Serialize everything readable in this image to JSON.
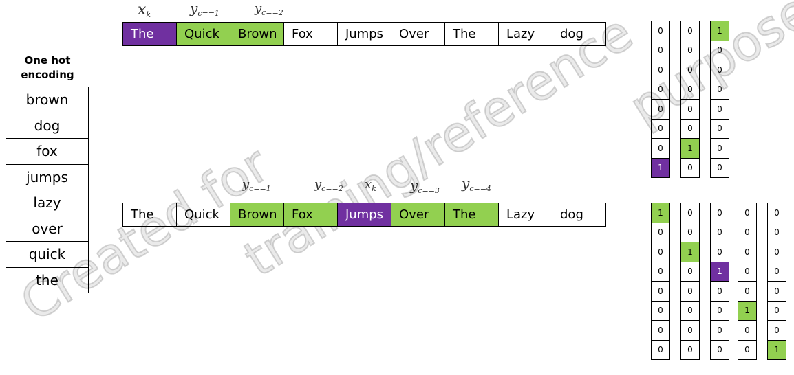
{
  "vocab": {
    "title_line1": "One hot",
    "title_line2": "encoding",
    "words": [
      "brown",
      "dog",
      "fox",
      "jumps",
      "lazy",
      "over",
      "quick",
      "the"
    ]
  },
  "top": {
    "tokens": [
      {
        "text": "The",
        "hl": "purple"
      },
      {
        "text": "Quick",
        "hl": "green"
      },
      {
        "text": "Brown",
        "hl": "green"
      },
      {
        "text": "Fox",
        "hl": ""
      },
      {
        "text": "Jumps",
        "hl": ""
      },
      {
        "text": "Over",
        "hl": ""
      },
      {
        "text": "The",
        "hl": ""
      },
      {
        "text": "Lazy",
        "hl": ""
      },
      {
        "text": "dog",
        "hl": ""
      }
    ],
    "labels": [
      {
        "main": "x",
        "sub": "k"
      },
      {
        "main": "y",
        "sub": "c==1"
      },
      {
        "main": "y",
        "sub": "c==2"
      }
    ],
    "vectors": [
      {
        "values": [
          0,
          0,
          0,
          0,
          0,
          0,
          0,
          1
        ],
        "hot_color": "purple"
      },
      {
        "values": [
          0,
          0,
          0,
          0,
          0,
          0,
          1,
          0
        ],
        "hot_color": "green"
      },
      {
        "values": [
          1,
          0,
          0,
          0,
          0,
          0,
          0,
          0
        ],
        "hot_color": "green"
      }
    ]
  },
  "bottom": {
    "tokens": [
      {
        "text": "The",
        "hl": ""
      },
      {
        "text": "Quick",
        "hl": ""
      },
      {
        "text": "Brown",
        "hl": "green"
      },
      {
        "text": "Fox",
        "hl": "green"
      },
      {
        "text": "Jumps",
        "hl": "purple"
      },
      {
        "text": "Over",
        "hl": "green"
      },
      {
        "text": "The",
        "hl": "green"
      },
      {
        "text": "Lazy",
        "hl": ""
      },
      {
        "text": "dog",
        "hl": ""
      }
    ],
    "labels": [
      {
        "main": "y",
        "sub": "c==1"
      },
      {
        "main": "y",
        "sub": "c==2"
      },
      {
        "main": "x",
        "sub": "k"
      },
      {
        "main": "y",
        "sub": "c==3"
      },
      {
        "main": "y",
        "sub": "c==4"
      }
    ],
    "vectors": [
      {
        "values": [
          1,
          0,
          0,
          0,
          0,
          0,
          0,
          0
        ],
        "hot_color": "green"
      },
      {
        "values": [
          0,
          0,
          1,
          0,
          0,
          0,
          0,
          0
        ],
        "hot_color": "green"
      },
      {
        "values": [
          0,
          0,
          0,
          1,
          0,
          0,
          0,
          0
        ],
        "hot_color": "purple"
      },
      {
        "values": [
          0,
          0,
          0,
          0,
          0,
          1,
          0,
          0
        ],
        "hot_color": "green"
      },
      {
        "values": [
          0,
          0,
          0,
          0,
          0,
          0,
          0,
          1
        ],
        "hot_color": "green"
      }
    ]
  },
  "watermark": {
    "line1": "Created for",
    "line2": "training/reference",
    "line3": "purposes"
  },
  "colors": {
    "purple": "#7030a0",
    "green": "#92d050"
  }
}
